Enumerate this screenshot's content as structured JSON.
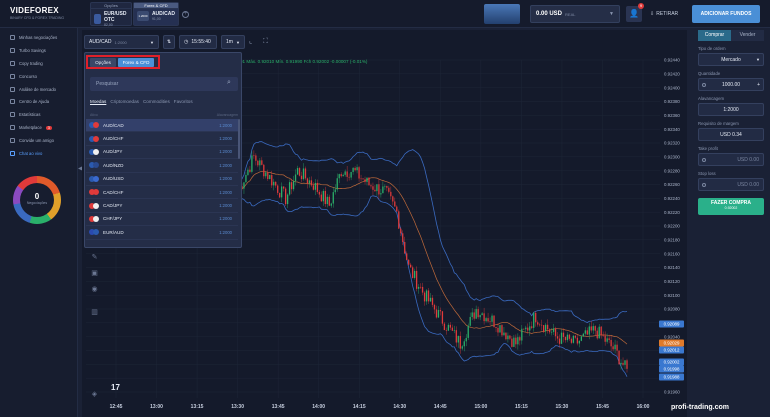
{
  "logo": {
    "name": "VIDEFOREX",
    "tagline": "BINARY CFD & FOREX TRADING"
  },
  "asset_tabs": [
    {
      "header": "Opções",
      "symbol": "EUR/USD OTC",
      "price": "82,00",
      "active": false
    },
    {
      "header": "Forex & CFD",
      "symbol": "AUD/CAD",
      "price": "91,00",
      "chip": "1.2000",
      "active": true
    }
  ],
  "balance": {
    "value": "0.00 USD",
    "label": "REAL"
  },
  "notification_count": "9",
  "withdraw_label": "RETIRAR",
  "deposit_label": "ADICIONAR FUNDOS",
  "sidebar": {
    "items": [
      {
        "label": "Minhas negociações"
      },
      {
        "label": "Turbo Savings"
      },
      {
        "label": "Copy trading"
      },
      {
        "label": "Concurso"
      },
      {
        "label": "Análise de mercado"
      },
      {
        "label": "Centro de Ajuda"
      },
      {
        "label": "Estatísticas"
      },
      {
        "label": "Marketplace",
        "badge": "3"
      },
      {
        "label": "Convide um amigo"
      },
      {
        "label": "Chat ao vivo",
        "selected": true
      }
    ],
    "negotiations_count": "0",
    "negotiations_label": "Negociações"
  },
  "toolbar": {
    "symbol": "AUD/CAD",
    "leverage": "1:2000",
    "time": "15:55:40",
    "timeframe": "1m"
  },
  "ohlc_line": "91  Máx. 0.92010  Mín. 0.91990  Fch 0.92002  -0.00007 (-0.01%)",
  "dropdown": {
    "tabs": [
      "Opções",
      "Forex & CFD"
    ],
    "search_placeholder": "Pesquisar",
    "categories": [
      "Moedas",
      "Criptomoedas",
      "Commodities",
      "Favoritos"
    ],
    "header_asset": "Ativo",
    "header_leverage": "Alavancagem",
    "rows": [
      {
        "symbol": "AUD/CAD",
        "leverage": "1:2000",
        "c1": "#2a5ab0",
        "c2": "#e03a3a"
      },
      {
        "symbol": "AUD/CHF",
        "leverage": "1:2000",
        "c1": "#2a5ab0",
        "c2": "#e03a3a"
      },
      {
        "symbol": "AUD/JPY",
        "leverage": "1:2000",
        "c1": "#2a5ab0",
        "c2": "#f0f0f0"
      },
      {
        "symbol": "AUD/NZD",
        "leverage": "1:2000",
        "c1": "#2a5ab0",
        "c2": "#2a4a90"
      },
      {
        "symbol": "AUD/USD",
        "leverage": "1:2000",
        "c1": "#2a5ab0",
        "c2": "#3a6ad0"
      },
      {
        "symbol": "CAD/CHF",
        "leverage": "1:2000",
        "c1": "#e03a3a",
        "c2": "#e03a3a"
      },
      {
        "symbol": "CAD/JPY",
        "leverage": "1:2000",
        "c1": "#e03a3a",
        "c2": "#f0f0f0"
      },
      {
        "symbol": "CHF/JPY",
        "leverage": "1:2000",
        "c1": "#e03a3a",
        "c2": "#f0f0f0"
      },
      {
        "symbol": "EUR/AUD",
        "leverage": "1:2000",
        "c1": "#2a4ab0",
        "c2": "#2a5ab0"
      }
    ]
  },
  "order_panel": {
    "buy_tab": "Comprar",
    "sell_tab": "Vender",
    "order_type_label": "Tipo de ordem",
    "order_type": "Mercado",
    "quantity_label": "Quantidade",
    "quantity": "1000.00",
    "leverage_label": "Alavancagem",
    "leverage": "1:2000",
    "margin_label": "Requisito de margem",
    "margin": "USD 0.34",
    "take_profit_label": "Take profit",
    "take_profit": "USD 0.00",
    "stop_loss_label": "Stop loss",
    "stop_loss": "USD 0.00",
    "buy_button": "FAZER COMPRA",
    "buy_button_sub": "0.92002"
  },
  "chart_data": {
    "type": "candlestick",
    "x_ticks": [
      "12:45",
      "13:00",
      "13:15",
      "13:30",
      "13:45",
      "14:00",
      "14:15",
      "14:30",
      "14:45",
      "15:00",
      "15:15",
      "15:30",
      "15:45",
      "16:00"
    ],
    "y_ticks": [
      "0.92440",
      "0.92420",
      "0.92400",
      "0.92380",
      "0.92360",
      "0.92340",
      "0.92320",
      "0.92300",
      "0.92280",
      "0.92260",
      "0.92240",
      "0.92220",
      "0.92200",
      "0.92180",
      "0.92160",
      "0.92140",
      "0.92120",
      "0.92100",
      "0.92080",
      "0.92060",
      "0.92040",
      "0.92020",
      "0.92000",
      "0.91980",
      "0.91960"
    ],
    "ylim": [
      0.9196,
      0.9244
    ],
    "price_markers": [
      {
        "value": "0.92089",
        "color": "#3a78d0"
      },
      {
        "value": "0.92029",
        "color": "#e07a2a"
      },
      {
        "value": "0.92012",
        "color": "#3a78d0"
      },
      {
        "value": "0.92002",
        "color": "#3a78d0"
      },
      {
        "value": "0.91998",
        "color": "#3a78d0"
      },
      {
        "value": "0.91988",
        "color": "#3a78d0"
      }
    ],
    "series": [
      {
        "name": "price",
        "key_points": [
          [
            0,
            0.9225
          ],
          [
            8,
            0.923
          ],
          [
            16,
            0.9227
          ],
          [
            24,
            0.9224
          ],
          [
            30,
            0.9228
          ],
          [
            38,
            0.9226
          ],
          [
            46,
            0.9223
          ],
          [
            52,
            0.9228
          ],
          [
            58,
            0.9228
          ],
          [
            66,
            0.9226
          ],
          [
            74,
            0.9225
          ],
          [
            80,
            0.9222
          ],
          [
            86,
            0.9214
          ],
          [
            94,
            0.921
          ],
          [
            104,
            0.9206
          ],
          [
            112,
            0.9203
          ],
          [
            120,
            0.9208
          ],
          [
            130,
            0.9206
          ],
          [
            140,
            0.9203
          ],
          [
            150,
            0.9207
          ],
          [
            160,
            0.9204
          ],
          [
            170,
            0.9203
          ],
          [
            180,
            0.9205
          ],
          [
            190,
            0.9202
          ],
          [
            196,
            0.9199
          ]
        ]
      }
    ]
  },
  "watermark": "profi-trading.com"
}
